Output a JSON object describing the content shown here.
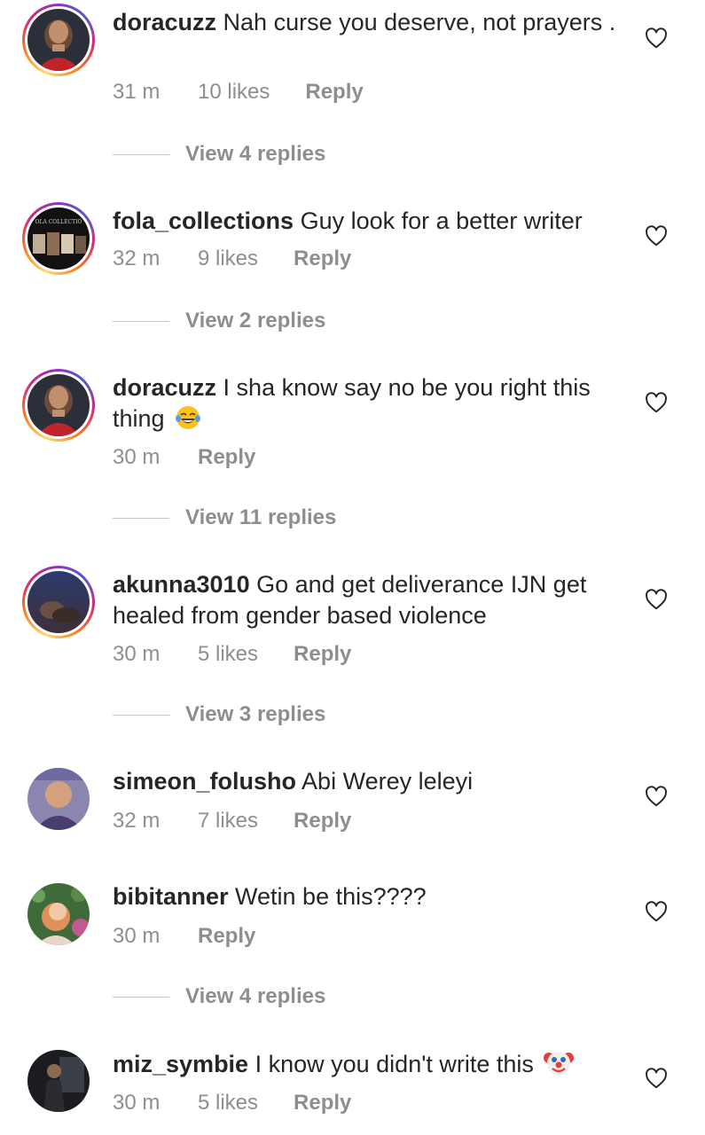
{
  "comments": [
    {
      "username": "doracuzz",
      "text": "Nah curse you deserve, not prayers .",
      "time": "31 m",
      "likes": "10 likes",
      "reply": "Reply",
      "view_replies": "View 4 replies"
    },
    {
      "username": "fola_collections",
      "text": "Guy look for a better writer",
      "time": "32 m",
      "likes": "9 likes",
      "reply": "Reply",
      "view_replies": "View 2 replies",
      "avatar_text": "OLA COLLECTIO"
    },
    {
      "username": "doracuzz",
      "text": "I sha know say no be you right this thing",
      "time": "30 m",
      "reply": "Reply",
      "view_replies": "View 11 replies",
      "emoji": "laughing-tears-emoji"
    },
    {
      "username": "akunna3010",
      "text": "Go and get deliverance IJN get healed from gender based violence",
      "time": "30 m",
      "likes": "5 likes",
      "reply": "Reply",
      "view_replies": "View 3 replies"
    },
    {
      "username": "simeon_folusho",
      "text": "Abi Werey leleyi",
      "time": "32 m",
      "likes": "7 likes",
      "reply": "Reply"
    },
    {
      "username": "bibitanner",
      "text": "Wetin be this????",
      "time": "30 m",
      "reply": "Reply",
      "view_replies": "View 4 replies"
    },
    {
      "username": "miz_symbie",
      "text": "I know you didn't write this",
      "time": "30 m",
      "likes": "5 likes",
      "reply": "Reply",
      "emoji": "clown-face-emoji"
    }
  ],
  "icons": {
    "like": "heart-outline-icon"
  },
  "colors": {
    "text": "#262626",
    "secondary": "#8e8e8e",
    "divider": "#c7c7c7",
    "story_ring": [
      "#feda75",
      "#fa7e1e",
      "#d62976",
      "#962fbf",
      "#4f5bd5"
    ]
  }
}
